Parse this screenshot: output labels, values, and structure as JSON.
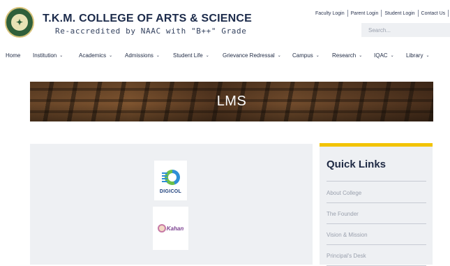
{
  "header": {
    "college_name": "T.K.M. COLLEGE OF ARTS & SCIENCE",
    "accreditation": "Re-accredited by NAAC with \"B++\" Grade",
    "top_links": [
      "Faculty Login",
      "Parent Login",
      "Student Login",
      "Contact Us"
    ],
    "search_placeholder": "Search..."
  },
  "nav": {
    "items": [
      {
        "label": "Home",
        "has_dropdown": false
      },
      {
        "label": "Institution",
        "has_dropdown": true
      },
      {
        "label": "Academics",
        "has_dropdown": true
      },
      {
        "label": "Admissions",
        "has_dropdown": true
      },
      {
        "label": "Student Life",
        "has_dropdown": true
      },
      {
        "label": "Grievance Redressal",
        "has_dropdown": true
      },
      {
        "label": "Campus",
        "has_dropdown": true
      },
      {
        "label": "Research",
        "has_dropdown": true
      },
      {
        "label": "IQAC",
        "has_dropdown": true
      },
      {
        "label": "Library",
        "has_dropdown": true
      }
    ],
    "chevron": "⌄"
  },
  "banner": {
    "title": "LMS"
  },
  "content": {
    "apps": [
      {
        "label": "DIGICOL",
        "icon": "digicol-logo"
      },
      {
        "label": "Kahan",
        "icon": "kahan-logo"
      }
    ]
  },
  "sidebar": {
    "title": "Quick Links",
    "links": [
      "About College",
      "The Founder",
      "Vision & Mission",
      "Principal's Desk"
    ]
  },
  "colors": {
    "accent": "#f2c300",
    "navy": "#1f2a44",
    "panel": "#eef0f3"
  }
}
